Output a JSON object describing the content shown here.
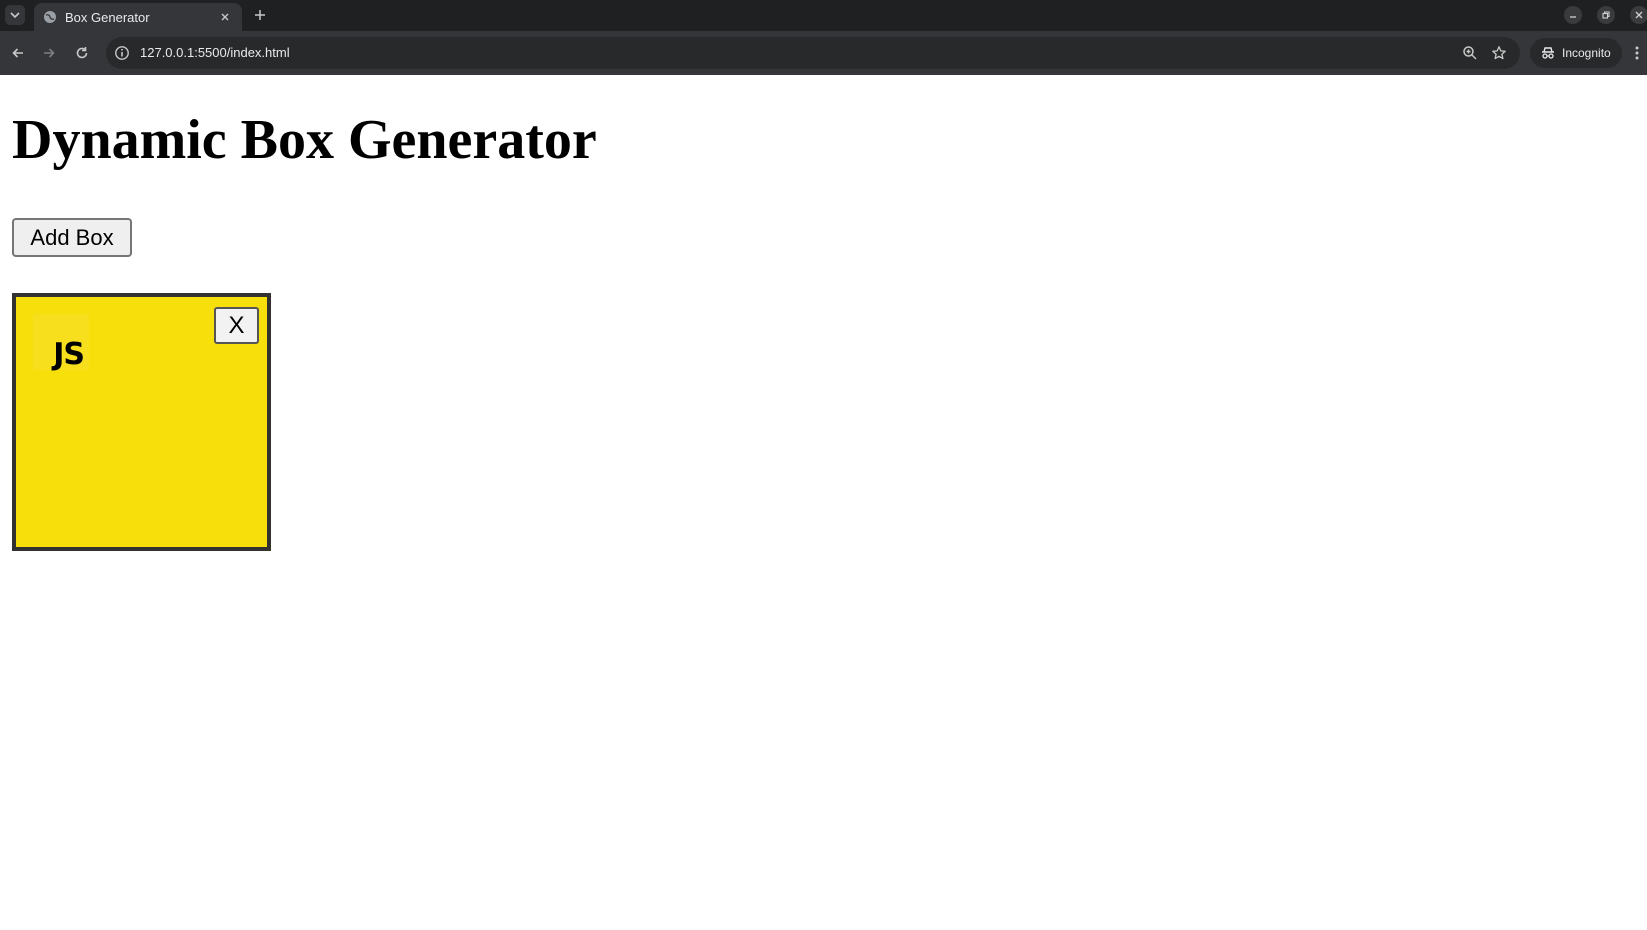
{
  "browser": {
    "tab": {
      "title": "Box Generator"
    },
    "address_bar": {
      "url": "127.0.0.1:5500/index.html"
    },
    "profile": {
      "label": "Incognito"
    }
  },
  "page": {
    "title": "Dynamic Box Generator",
    "add_button_label": "Add Box",
    "boxes": [
      {
        "logo_text": "JS",
        "close_label": "X",
        "color": "#f7df0c"
      }
    ]
  }
}
